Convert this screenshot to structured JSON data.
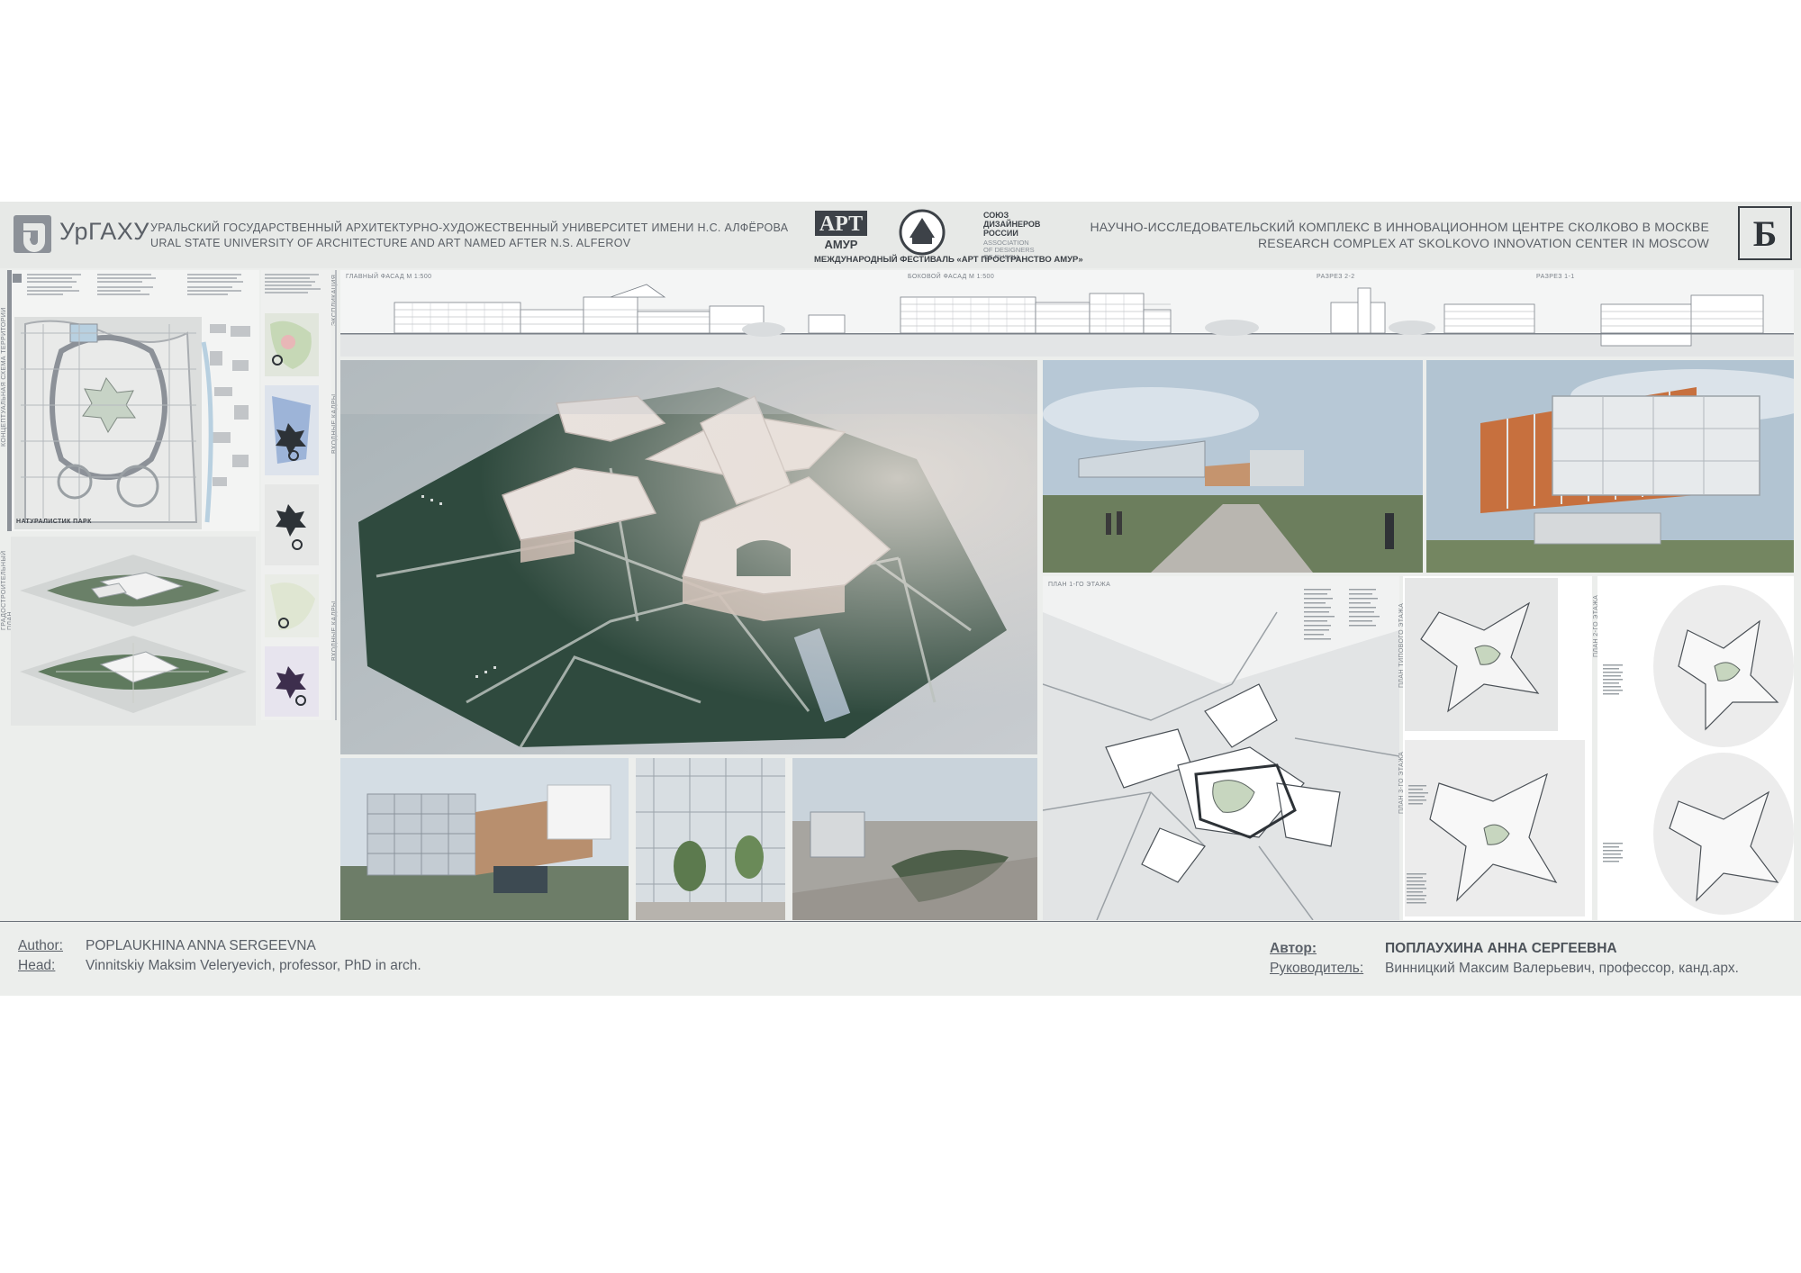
{
  "header": {
    "logo_text": "УрГАХУ",
    "university_ru": "УРАЛЬСКИЙ ГОСУДАРСТВЕННЫЙ АРХИТЕКТУРНО-ХУДОЖЕСТВЕННЫЙ УНИВЕРСИТЕТ ИМЕНИ Н.С. АЛФЁРОВА",
    "university_en": "URAL STATE UNIVERSITY OF ARCHITECTURE AND ART NAMED AFTER N.S. ALFEROV",
    "festival_caption": "МЕЖДУНАРОДНЫЙ ФЕСТИВАЛЬ «АРТ ПРОСТРАНСТВО АМУР»",
    "art_logo_top": "АРТ",
    "art_logo_bottom": "АМУР",
    "union_ru": [
      "СОЮЗ",
      "ДИЗАЙНЕРОВ",
      "РОССИИ"
    ],
    "union_en": [
      "ASSOCIATION",
      "OF DESIGNERS",
      "OF RUSSIA"
    ],
    "project_ru": "НАУЧНО-ИССЛЕДОВАТЕЛЬСКИЙ КОМПЛЕКС В ИННОВАЦИОННОМ ЦЕНТРЕ СКОЛКОВО В МОСКВЕ",
    "project_en": "RESEARCH COMPLEX AT SKOLKOVO INNOVATION CENTER IN MOSCOW",
    "badge": "Б"
  },
  "labels": {
    "main_facade": "ГЛАВНЫЙ ФАСАД М 1:500",
    "side_facade": "БОКОВОЙ ФАСАД М 1:500",
    "section_22": "РАЗРЕЗ 2-2",
    "section_11": "РАЗРЕЗ 1-1",
    "plan_1": "ПЛАН 1-ГО ЭТАЖА",
    "plan_typical": "ПЛАН ТИПОВОГО ЭТАЖА",
    "plan_2": "ПЛАН 2-ГО ЭТАЖА",
    "plan_3": "ПЛАН 3-ГО ЭТАЖА",
    "park_label": "НАТУРАЛИСТИК ПАРК",
    "left_vert_1": "КОНЦЕПТУАЛЬНАЯ СХЕМА ТЕРРИТОРИИ",
    "left_vert_2": "ГРАДОСТРОИТЕЛЬНЫЙ ПЛАН",
    "left_vert_3": "ЭКСПЛИКАЦИЯ",
    "left_vert_4": "ВХОДНЫЕ КАДРЫ",
    "left_vert_5": "ВХОДНЫЕ КАДРЫ"
  },
  "footer": {
    "author_label_en": "Author:",
    "author_en": "POPLAUKHINA ANNA SERGEEVNA",
    "head_label_en": "Head:",
    "head_en": "Vinnitskiy Maksim Veleryevich, professor, PhD in arch.",
    "author_label_ru": "Автор:",
    "author_ru": "ПОПЛАУХИНА АННА СЕРГЕЕВНА",
    "head_label_ru": "Руководитель:",
    "head_ru": "Винницкий Максим Валерьевич, профессор, канд.арх."
  },
  "icons": [
    "urgahu-logo-icon",
    "art-amur-logo-icon",
    "amgu-seal-icon",
    "union-designers-logo-icon"
  ]
}
